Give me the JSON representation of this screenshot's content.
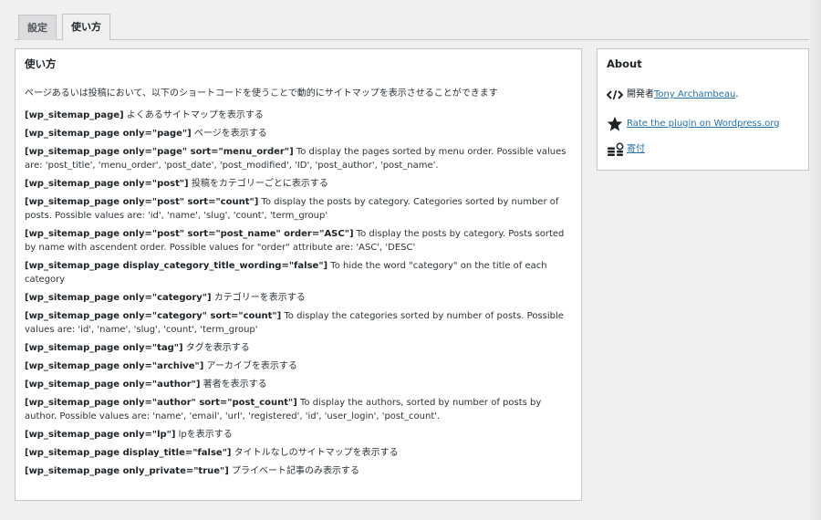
{
  "tabs": [
    {
      "label": "設定",
      "active": false
    },
    {
      "label": "使い方",
      "active": true
    }
  ],
  "main": {
    "title": "使い方",
    "intro": "ページあるいは投稿において、以下のショートコードを使うことで動的にサイトマップを表示させることができます",
    "items": [
      {
        "code": "[wp_sitemap_page]",
        "desc": " よくあるサイトマップを表示する"
      },
      {
        "code": "[wp_sitemap_page only=\"page\"]",
        "desc": " ページを表示する"
      },
      {
        "code": "[wp_sitemap_page only=\"page\" sort=\"menu_order\"]",
        "desc": " To display the pages sorted by menu order. Possible values are: 'post_title', 'menu_order', 'post_date', 'post_modified', 'ID', 'post_author', 'post_name'."
      },
      {
        "code": "[wp_sitemap_page only=\"post\"]",
        "desc": " 投稿をカテゴリーごとに表示する"
      },
      {
        "code": "[wp_sitemap_page only=\"post\" sort=\"count\"]",
        "desc": " To display the posts by category. Categories sorted by number of posts. Possible values are: 'id', 'name', 'slug', 'count', 'term_group'"
      },
      {
        "code": "[wp_sitemap_page only=\"post\" sort=\"post_name\" order=\"ASC\"]",
        "desc": " To display the posts by category. Posts sorted by name with ascendent order. Possible values for \"order\" attribute are: 'ASC', 'DESC'"
      },
      {
        "code": "[wp_sitemap_page display_category_title_wording=\"false\"]",
        "desc": " To hide the word \"category\" on the title of each category"
      },
      {
        "code": "[wp_sitemap_page only=\"category\"]",
        "desc": " カテゴリーを表示する"
      },
      {
        "code": "[wp_sitemap_page only=\"category\" sort=\"count\"]",
        "desc": " To display the categories sorted by number of posts. Possible values are: 'id', 'name', 'slug', 'count', 'term_group'"
      },
      {
        "code": "[wp_sitemap_page only=\"tag\"]",
        "desc": " タグを表示する"
      },
      {
        "code": "[wp_sitemap_page only=\"archive\"]",
        "desc": " アーカイブを表示する"
      },
      {
        "code": "[wp_sitemap_page only=\"author\"]",
        "desc": " 著者を表示する"
      },
      {
        "code": "[wp_sitemap_page only=\"author\" sort=\"post_count\"]",
        "desc": " To display the authors, sorted by number of posts by author. Possible values are: 'name', 'email', 'url', 'registered', 'id', 'user_login', 'post_count'."
      },
      {
        "code": "[wp_sitemap_page only=\"lp\"]",
        "desc": " lpを表示する"
      },
      {
        "code": "[wp_sitemap_page display_title=\"false\"]",
        "desc": " タイトルなしのサイトマップを表示する"
      },
      {
        "code": "[wp_sitemap_page only_private=\"true\"]",
        "desc": " プライベート記事のみ表示する"
      }
    ]
  },
  "about": {
    "title": "About",
    "developer_label": "開発者 ",
    "developer_name": "Tony Archambeau",
    "developer_suffix": ".",
    "rate_label": "Rate the plugin on Wordpress.org",
    "donate_label": "寄付",
    "icons": {
      "developer": "code-icon",
      "rate": "star-icon",
      "donate": "coins-icon"
    }
  },
  "colors": {
    "link": "#2271b1",
    "background": "#f0f0f1",
    "border": "#c3c4c7"
  }
}
